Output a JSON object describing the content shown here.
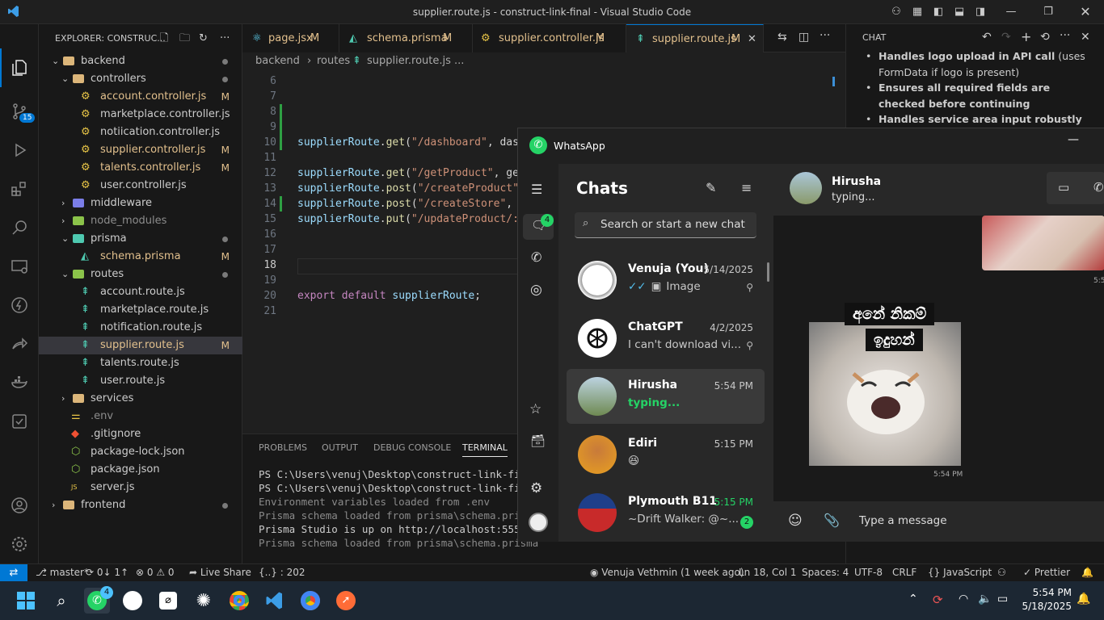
{
  "window_title": "supplier.route.js - construct-link-final - Visual Studio Code",
  "explorer": {
    "header": "EXPLORER: CONSTRUC...",
    "rows": [
      {
        "label": "backend",
        "badge": "",
        "dot": true
      },
      {
        "label": "controllers",
        "badge": "",
        "dot": true
      },
      {
        "label": "account.controller.js",
        "badge": "M",
        "dot": false
      },
      {
        "label": "marketplace.controller.js",
        "badge": "",
        "dot": false
      },
      {
        "label": "notiication.controller.js",
        "badge": "",
        "dot": false
      },
      {
        "label": "supplier.controller.js",
        "badge": "M",
        "dot": false
      },
      {
        "label": "talents.controller.js",
        "badge": "M",
        "dot": false
      },
      {
        "label": "user.controller.js",
        "badge": "",
        "dot": false
      },
      {
        "label": "middleware",
        "badge": "",
        "dot": false
      },
      {
        "label": "node_modules",
        "badge": "",
        "dot": false
      },
      {
        "label": "prisma",
        "badge": "",
        "dot": true
      },
      {
        "label": "schema.prisma",
        "badge": "M",
        "dot": false
      },
      {
        "label": "routes",
        "badge": "",
        "dot": true
      },
      {
        "label": "account.route.js",
        "badge": "",
        "dot": false
      },
      {
        "label": "marketplace.route.js",
        "badge": "",
        "dot": false
      },
      {
        "label": "notification.route.js",
        "badge": "",
        "dot": false
      },
      {
        "label": "supplier.route.js",
        "badge": "M",
        "dot": false
      },
      {
        "label": "talents.route.js",
        "badge": "",
        "dot": false
      },
      {
        "label": "user.route.js",
        "badge": "",
        "dot": false
      },
      {
        "label": "services",
        "badge": "",
        "dot": false
      },
      {
        "label": ".env",
        "badge": "",
        "dot": false
      },
      {
        "label": ".gitignore",
        "badge": "",
        "dot": false
      },
      {
        "label": "package-lock.json",
        "badge": "",
        "dot": false
      },
      {
        "label": "package.json",
        "badge": "",
        "dot": false
      },
      {
        "label": "server.js",
        "badge": "",
        "dot": false
      },
      {
        "label": "frontend",
        "badge": "",
        "dot": true
      }
    ]
  },
  "tabs": [
    {
      "label": "page.jsx",
      "badge": "M"
    },
    {
      "label": "schema.prisma",
      "badge": "M"
    },
    {
      "label": "supplier.controller.js",
      "badge": "M"
    },
    {
      "label": "supplier.route.js",
      "badge": "M"
    }
  ],
  "breadcrumb": {
    "a": "backend",
    "b": "routes",
    "c": "supplier.route.js",
    "d": "..."
  },
  "code": {
    "line_numbers": [
      "6",
      "7",
      "8",
      "9",
      "10",
      "11",
      "12",
      "13",
      "14",
      "15",
      "16",
      "17",
      "18",
      "19",
      "20",
      "21"
    ],
    "lines": [
      "",
      "",
      "",
      "",
      "supplierRoute.get(\"/dashboard\", dash",
      "",
      "supplierRoute.get(\"/getProduct\", get",
      "supplierRoute.post(\"/createProduct\",",
      "supplierRoute.post(\"/createStore\", c",
      "supplierRoute.put(\"/updateProduct/:i",
      "",
      "",
      "",
      "",
      "export default supplierRoute;",
      ""
    ]
  },
  "panel": {
    "tabs": [
      "PROBLEMS",
      "OUTPUT",
      "DEBUG CONSOLE",
      "TERMINAL"
    ],
    "terminal": [
      "PS C:\\Users\\venuj\\Desktop\\construct-link-final",
      "PS C:\\Users\\venuj\\Desktop\\construct-link-final",
      "Environment variables loaded from .env",
      "Prisma schema loaded from prisma\\schema.prisma",
      "Prisma Studio is up on http://localhost:5555",
      "Prisma schema loaded from prisma\\schema.prisma"
    ]
  },
  "chat_panel": {
    "title": "CHAT",
    "bullets": [
      {
        "bold": "Handles logo upload in API call",
        "rest": " (uses FormData if logo is present)"
      },
      {
        "bold": "Ensures all required fields are checked before continuing",
        "rest": ""
      },
      {
        "bold": "Handles service area input robustly",
        "rest": ""
      }
    ]
  },
  "status": {
    "branch": "master*",
    "sync": "0↓ 1↑",
    "problems": "0",
    "warnings": "0",
    "live_share": "Live Share",
    "json": "{..} : 202",
    "blame": "Venuja Vethmin (1 week ago)",
    "position": "Ln 18, Col 1",
    "spaces": "Spaces: 4",
    "encoding": "UTF-8",
    "eol": "CRLF",
    "language": "JavaScript",
    "prettier": "Prettier"
  },
  "activity_badge": "15",
  "whatsapp": {
    "title": "WhatsApp",
    "chats_heading": "Chats",
    "search_placeholder": "Search or start a new chat",
    "nav_badge": "4",
    "chats": [
      {
        "name": "Venuja (You)",
        "time": "5/14/2025",
        "msg": "Image",
        "unread": ""
      },
      {
        "name": "ChatGPT",
        "time": "4/2/2025",
        "msg": "I can't download vi...",
        "unread": ""
      },
      {
        "name": "Hirusha",
        "time": "5:54 PM",
        "msg": "typing...",
        "unread": ""
      },
      {
        "name": "Ediri",
        "time": "5:15 PM",
        "msg": "😆",
        "unread": ""
      },
      {
        "name": "Plymouth B11",
        "time": "5:15 PM",
        "msg": "~Drift Walker: @~...",
        "unread": "2"
      }
    ],
    "header_name": "Hirusha",
    "header_status": "typing...",
    "sticker_text_1": "අනේ නිකම්",
    "sticker_text_2": "ඉදුහන්",
    "sticker_time": "5:54 PM",
    "partial_time": "5:5",
    "message_placeholder": "Type a message"
  },
  "taskbar": {
    "time": "5:54 PM",
    "date": "5/18/2025",
    "whatsapp_badge": "4"
  },
  "colors": {
    "accent": "#0078d4",
    "modified": "#e2c08d",
    "wa_green": "#25d366",
    "func": "#dcdcaa",
    "string": "#ce9178",
    "var": "#9cdcfe",
    "keyword": "#c586c0"
  }
}
